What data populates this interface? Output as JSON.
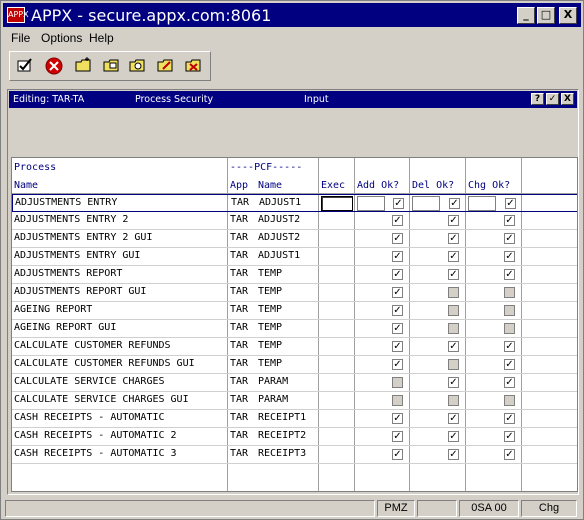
{
  "window": {
    "title": "APPX - secure.appx.com:8061",
    "icon_label": "APPX",
    "buttons": {
      "minimize": "_",
      "maximize": "□",
      "close": "X"
    }
  },
  "menu": [
    "File",
    "Options",
    "Help"
  ],
  "toolbar_icons": [
    "check-icon",
    "cancel-icon",
    "new-folder-icon",
    "open-folder-icon",
    "find-folder-icon",
    "edit-folder-icon",
    "delete-folder-icon"
  ],
  "inner": {
    "editing": "Editing: TAR-TA",
    "process": "Process Security",
    "mode": "Input",
    "buttons": {
      "help": "?",
      "ok": "✓",
      "close": "X"
    }
  },
  "grid": {
    "header": {
      "process_top": "Process",
      "process_bottom": "Name",
      "pcf_top": "----PCF-----",
      "app": "App",
      "name": "Name",
      "exec": "Exec",
      "add": "Add Ok?",
      "del": "Del Ok?",
      "chg": "Chg Ok?"
    },
    "rows": [
      {
        "process": "ADJUSTMENTS ENTRY",
        "app": "TAR",
        "name": "ADJUST1",
        "add": true,
        "del": true,
        "chg": true
      },
      {
        "process": "ADJUSTMENTS ENTRY 2",
        "app": "TAR",
        "name": "ADJUST2",
        "add": true,
        "del": true,
        "chg": true
      },
      {
        "process": "ADJUSTMENTS ENTRY 2 GUI",
        "app": "TAR",
        "name": "ADJUST2",
        "add": true,
        "del": true,
        "chg": true
      },
      {
        "process": "ADJUSTMENTS ENTRY GUI",
        "app": "TAR",
        "name": "ADJUST1",
        "add": true,
        "del": true,
        "chg": true
      },
      {
        "process": "ADJUSTMENTS REPORT",
        "app": "TAR",
        "name": "TEMP",
        "add": true,
        "del": true,
        "chg": true
      },
      {
        "process": "ADJUSTMENTS REPORT GUI",
        "app": "TAR",
        "name": "TEMP",
        "add": true,
        "del": false,
        "chg": false
      },
      {
        "process": "AGEING REPORT",
        "app": "TAR",
        "name": "TEMP",
        "add": true,
        "del": false,
        "chg": false
      },
      {
        "process": "AGEING REPORT GUI",
        "app": "TAR",
        "name": "TEMP",
        "add": true,
        "del": false,
        "chg": false
      },
      {
        "process": "CALCULATE CUSTOMER REFUNDS",
        "app": "TAR",
        "name": "TEMP",
        "add": true,
        "del": true,
        "chg": true
      },
      {
        "process": "CALCULATE CUSTOMER REFUNDS GUI",
        "app": "TAR",
        "name": "TEMP",
        "add": true,
        "del": false,
        "chg": true
      },
      {
        "process": "CALCULATE SERVICE CHARGES",
        "app": "TAR",
        "name": "PARAM",
        "add": false,
        "del": true,
        "chg": true
      },
      {
        "process": "CALCULATE SERVICE CHARGES GUI",
        "app": "TAR",
        "name": "PARAM",
        "add": false,
        "del": false,
        "chg": false
      },
      {
        "process": "CASH RECEIPTS - AUTOMATIC",
        "app": "TAR",
        "name": "RECEIPT1",
        "add": true,
        "del": true,
        "chg": true
      },
      {
        "process": "CASH RECEIPTS - AUTOMATIC 2",
        "app": "TAR",
        "name": "RECEIPT2",
        "add": true,
        "del": true,
        "chg": true
      },
      {
        "process": "CASH RECEIPTS - AUTOMATIC 3",
        "app": "TAR",
        "name": "RECEIPT3",
        "add": true,
        "del": true,
        "chg": true
      }
    ]
  },
  "status": {
    "cell1": "",
    "cell2": "PMZ",
    "cell3": "",
    "cell4": "0SA 00",
    "cell5": "Chg"
  }
}
